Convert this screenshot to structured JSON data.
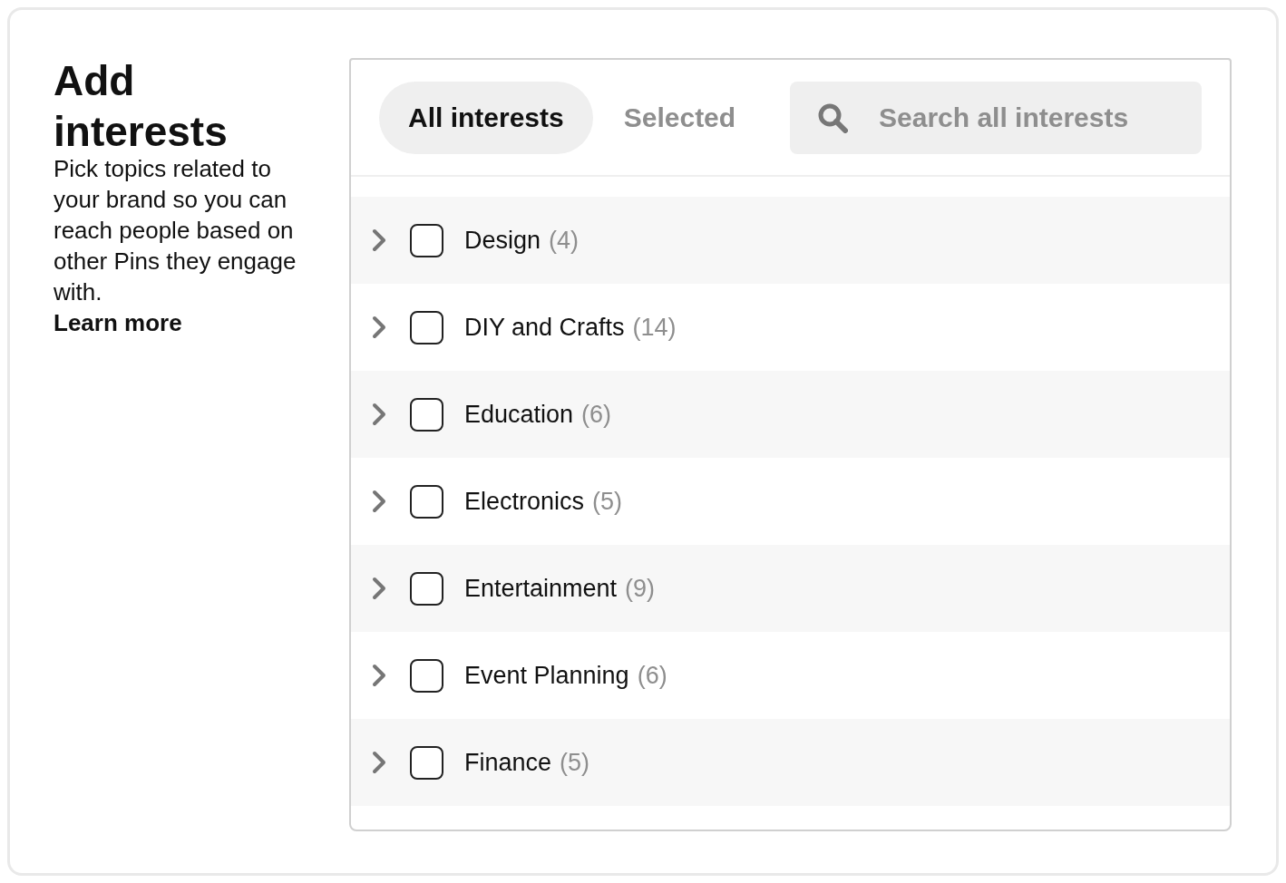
{
  "intro": {
    "title": "Add interests",
    "description": "Pick topics related to your brand so you can reach people based on other Pins they engage with.",
    "link": "Learn more"
  },
  "tabs": [
    {
      "label": "All interests",
      "selected": true
    },
    {
      "label": "Selected",
      "selected": false
    }
  ],
  "search": {
    "placeholder": "Search all interests"
  },
  "interests": [
    {
      "name": "Design",
      "count": "(4)",
      "checked": false,
      "expanded": false
    },
    {
      "name": "DIY and Crafts",
      "count": "(14)",
      "checked": false,
      "expanded": false
    },
    {
      "name": "Education",
      "count": "(6)",
      "checked": false,
      "expanded": false
    },
    {
      "name": "Electronics",
      "count": "(5)",
      "checked": false,
      "expanded": false
    },
    {
      "name": "Entertainment",
      "count": "(9)",
      "checked": false,
      "expanded": false
    },
    {
      "name": "Event Planning",
      "count": "(6)",
      "checked": false,
      "expanded": false
    },
    {
      "name": "Finance",
      "count": "(5)",
      "checked": false,
      "expanded": false
    }
  ]
}
